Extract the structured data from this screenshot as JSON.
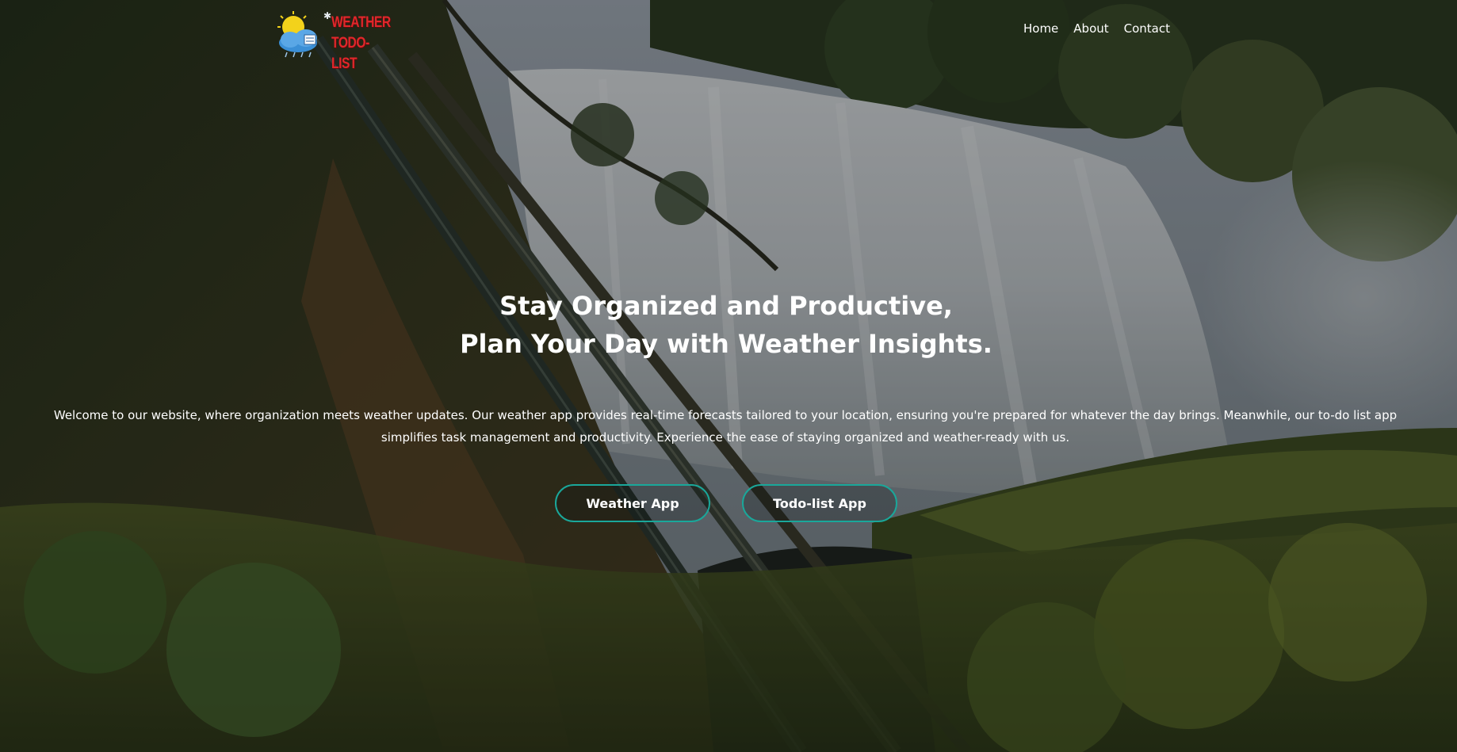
{
  "brand": {
    "logo_line1": "WEATHER",
    "logo_line2": "TODO-LIST",
    "logo_color": "#e0272b"
  },
  "nav": {
    "links": [
      "Home",
      "About",
      "Contact"
    ]
  },
  "hero": {
    "headline_line1": "Stay Organized and Productive,",
    "headline_line2": "Plan Your Day with Weather Insights.",
    "intro": "Welcome to our website, where organization meets weather updates. Our weather app provides real-time forecasts tailored to your location, ensuring you're prepared for whatever the day brings. Meanwhile, our to-do list app simplifies task management and productivity. Experience the ease of staying organized and weather-ready with us.",
    "buttons": [
      "Weather App",
      "Todo-list App"
    ],
    "button_border_color": "#1aa79a",
    "background_image": "waterfall-forest-photo"
  }
}
